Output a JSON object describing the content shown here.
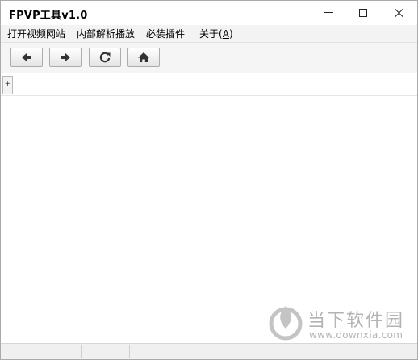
{
  "window": {
    "title": "FPVP工具v1.0",
    "controls": {
      "minimize_icon": "minimize-icon",
      "maximize_icon": "maximize-icon",
      "close_icon": "close-icon"
    }
  },
  "menu": {
    "items": [
      {
        "label": "打开视频网站"
      },
      {
        "label": "内部解析播放"
      },
      {
        "label": "必装插件"
      },
      {
        "label_main": "关于(",
        "mnemonic": "A",
        "label_end": ")"
      }
    ]
  },
  "toolbar": {
    "buttons": [
      {
        "icon": "arrow-left-icon"
      },
      {
        "icon": "arrow-right-icon"
      },
      {
        "icon": "refresh-icon"
      },
      {
        "icon": "home-icon"
      }
    ]
  },
  "tabs": {
    "add_label": "+"
  },
  "watermark": {
    "name": "当下软件园",
    "url": "www.downxia.com"
  },
  "colors": {
    "watermark": "#b3b3b3",
    "menubar_bg": "#f3f3f3",
    "toolbar_bg": "#f5f5f5"
  }
}
